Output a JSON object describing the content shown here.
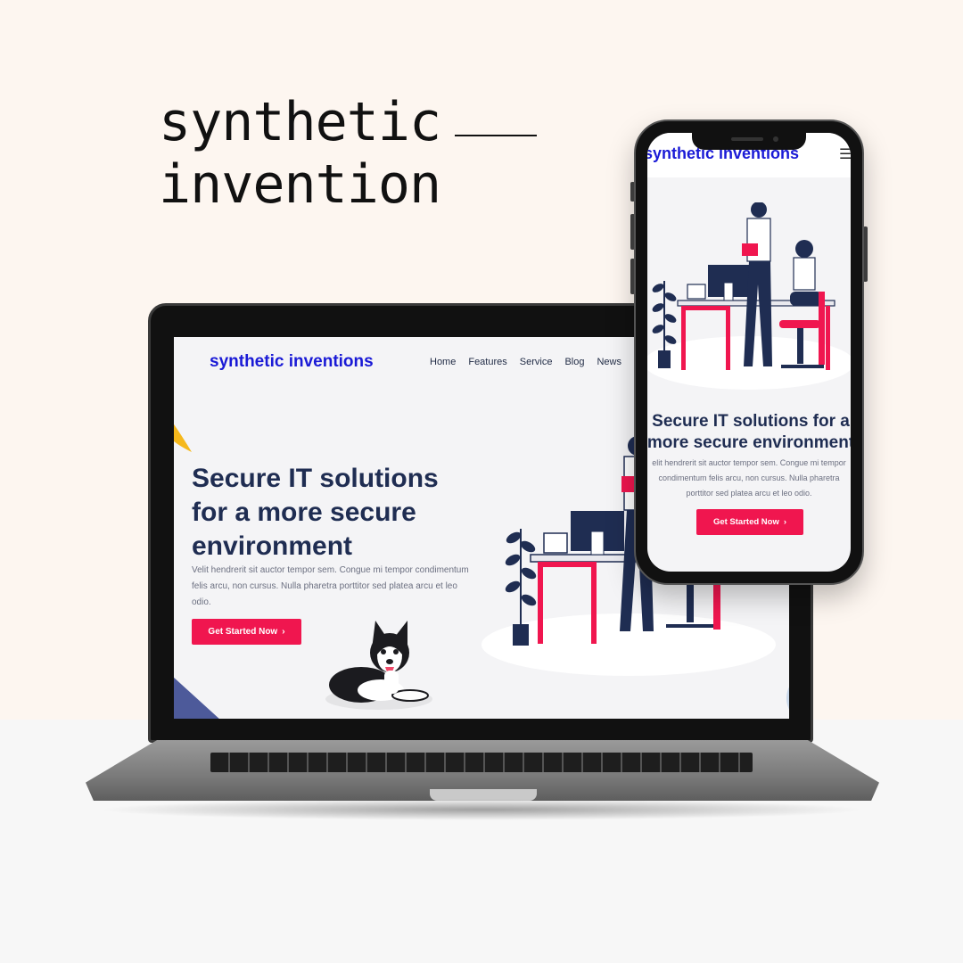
{
  "headline": {
    "line1": "synthetic",
    "line2": "invention"
  },
  "laptop_site": {
    "logo": "synthetic inventions",
    "nav": [
      "Home",
      "Features",
      "Service",
      "Blog",
      "News"
    ],
    "hero_title": "Secure IT solutions for a more secure environment",
    "hero_text": "Velit hendrerit sit auctor tempor sem. Congue mi tempor condimentum felis arcu, non cursus. Nulla pharetra porttitor sed platea arcu et leo odio.",
    "cta_label": "Get Started Now",
    "cta_chevron": "›"
  },
  "mobile_site": {
    "logo": "synthetic inventions",
    "menu_icon": "☰",
    "hero_title_line1": "Secure IT solutions for a",
    "hero_title_line2": "more secure environment",
    "hero_text": "elit hendrerit sit auctor tempor sem. Congue mi tempor condimentum felis arcu, non cursus. Nulla pharetra porttitor sed platea arcu et leo odio.",
    "cta_label": "Get Started Now",
    "cta_chevron": "›"
  },
  "colors": {
    "brand_blue": "#1a1ad6",
    "accent_red": "#f0164f",
    "navy": "#1f2d52",
    "background": "#fdf6f0"
  }
}
